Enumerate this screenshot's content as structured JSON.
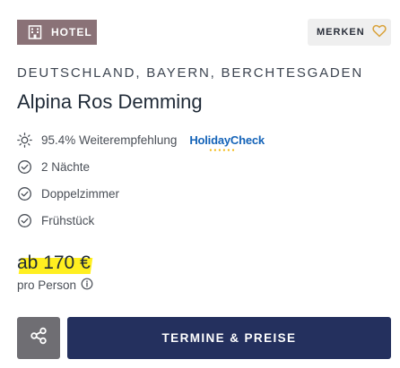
{
  "badge": {
    "label": "HOTEL",
    "icon": "hotel-building-icon"
  },
  "save": {
    "label": "MERKEN",
    "icon": "heart-icon"
  },
  "location": "DEUTSCHLAND, BAYERN, BERCHTESGADEN",
  "title": "Alpina Ros Demming",
  "features": [
    {
      "icon": "sun-icon",
      "text": "95.4% Weiterempfehlung"
    },
    {
      "icon": "check-circle-icon",
      "text": "2 Nächte"
    },
    {
      "icon": "check-circle-icon",
      "text": "Doppelzimmer"
    },
    {
      "icon": "check-circle-icon",
      "text": "Frühstück"
    }
  ],
  "holidaycheck": {
    "label": "HolidayCheck",
    "color": "#1463b8"
  },
  "price": {
    "prefix": "ab",
    "amount": "170 €",
    "per": "pro Person"
  },
  "buttons": {
    "share_icon": "share-icon",
    "cta": "TERMINE & PREISE"
  },
  "colors": {
    "badge_bg": "#8a7277",
    "cta_bg": "#24305e",
    "share_bg": "#6f6e73",
    "highlight": "#ffef20",
    "heart": "#d9a23a"
  }
}
